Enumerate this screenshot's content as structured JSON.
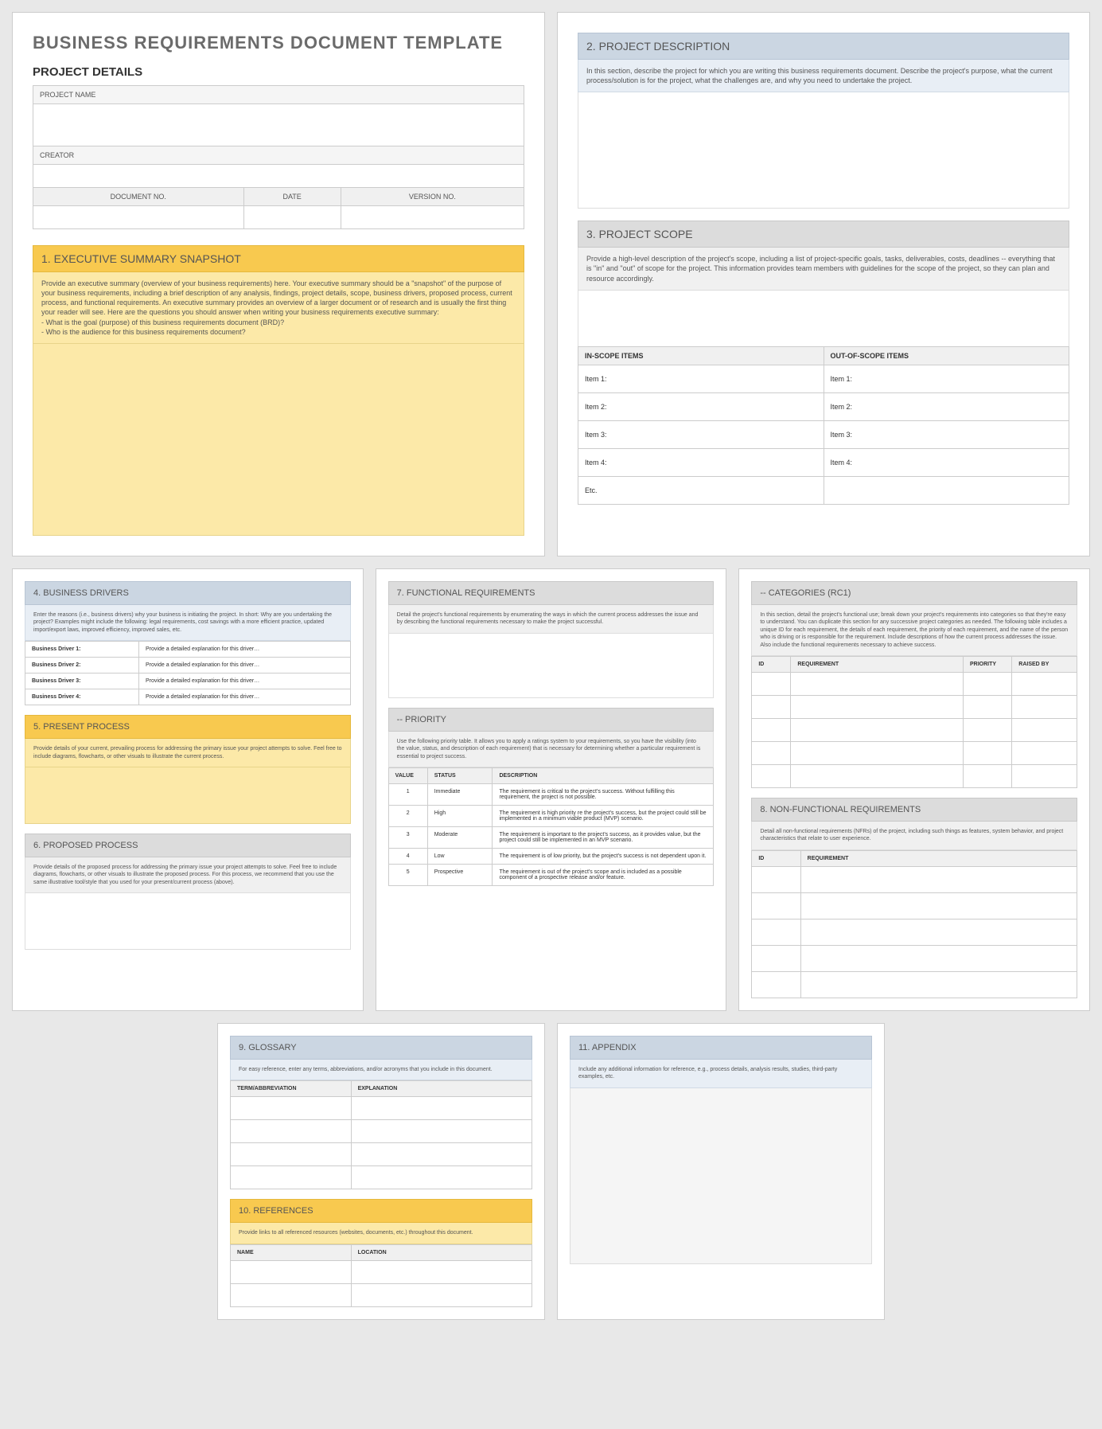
{
  "title": "BUSINESS REQUIREMENTS DOCUMENT TEMPLATE",
  "pd_title": "PROJECT DETAILS",
  "pn": "PROJECT NAME",
  "cr": "CREATOR",
  "docno": "DOCUMENT NO.",
  "date": "DATE",
  "ver": "VERSION NO.",
  "s1": {
    "h": "1. EXECUTIVE SUMMARY SNAPSHOT",
    "b": "Provide an executive summary (overview of your business requirements) here. Your executive summary should be a \"snapshot\" of the purpose of your business requirements, including a brief description of any analysis, findings, project details, scope, business drivers, proposed process, current process, and functional requirements. An executive summary provides an overview of a larger document or of research and is usually the first thing your reader will see. Here are the questions you should answer when writing your business requirements executive summary:\n- What is the goal (purpose) of this business requirements document (BRD)?\n- Who is the audience for this business requirements document?"
  },
  "s2": {
    "h": "2. PROJECT DESCRIPTION",
    "b": "In this section, describe the project for which you are writing this business requirements document. Describe the project's purpose, what the current process/solution is for the project, what the challenges are, and why you need to undertake the project."
  },
  "s3": {
    "h": "3. PROJECT SCOPE",
    "b": "Provide a high-level description of the project's scope, including a list of project-specific goals, tasks, deliverables, costs, deadlines -- everything that is \"in\" and \"out\" of scope for the project. This information provides team members with guidelines for the scope of the project, so they can plan and resource accordingly.",
    "in": "IN-SCOPE ITEMS",
    "out": "OUT-OF-SCOPE ITEMS",
    "rows": [
      "Item 1:",
      "Item 2:",
      "Item 3:",
      "Item 4:",
      "Etc."
    ]
  },
  "s4": {
    "h": "4. BUSINESS DRIVERS",
    "b": "Enter the reasons (i.e., business drivers) why your business is initiating the project. In short: Why are you undertaking the project? Examples might include the following: legal requirements, cost savings with a more efficient practice, updated import/export laws, improved efficiency, improved sales, etc.",
    "rows": [
      "Business Driver 1:",
      "Business Driver 2:",
      "Business Driver 3:",
      "Business Driver 4:"
    ],
    "exp": "Provide a detailed explanation for this driver…"
  },
  "s5": {
    "h": "5. PRESENT PROCESS",
    "b": "Provide details of your current, prevailing process for addressing the primary issue your project attempts to solve. Feel free to include diagrams, flowcharts, or other visuals to illustrate the current process."
  },
  "s6": {
    "h": "6. PROPOSED PROCESS",
    "b": "Provide details of the proposed process for addressing the primary issue your project attempts to solve. Feel free to include diagrams, flowcharts, or other visuals to illustrate the proposed process. For this process, we recommend that you use the same illustrative tool/style that you used for your present/current process (above)."
  },
  "s7": {
    "h": "7. FUNCTIONAL REQUIREMENTS",
    "b": "Detail the project's functional requirements by enumerating the ways in which the current process addresses the issue and by describing the functional requirements necessary to make the project successful."
  },
  "pr": {
    "h": "-- PRIORITY",
    "b": "Use the following priority table. It allows you to apply a ratings system to your requirements, so you have the visibility (into the value, status, and description of each requirement) that is necessary for determining whether a particular requirement is essential to project success.",
    "c1": "VALUE",
    "c2": "STATUS",
    "c3": "DESCRIPTION",
    "rows": [
      {
        "v": "1",
        "s": "Immediate",
        "d": "The requirement is critical to the project's success. Without fulfilling this requirement, the project is not possible."
      },
      {
        "v": "2",
        "s": "High",
        "d": "The requirement is high priority re the project's success, but the project could still be implemented in a minimum viable product (MVP) scenario."
      },
      {
        "v": "3",
        "s": "Moderate",
        "d": "The requirement is important to the project's success, as it provides value, but the project could still be implemented in an MVP scenario."
      },
      {
        "v": "4",
        "s": "Low",
        "d": "The requirement is of low priority, but the project's success is not dependent upon it."
      },
      {
        "v": "5",
        "s": "Prospective",
        "d": "The requirement is out of the project's scope and is included as a possible component of a prospective release and/or feature."
      }
    ]
  },
  "cat": {
    "h": "-- CATEGORIES (RC1)",
    "b": "In this section, detail the project's functional use; break down your project's requirements into categories so that they're easy to understand. You can duplicate this section for any successive project categories as needed. The following table includes a unique ID for each requirement, the details of each requirement, the priority of each requirement, and the name of the person who is driving or is responsible for the requirement. Include descriptions of how the current process addresses the issue. Also include the functional requirements necessary to achieve success.",
    "c1": "ID",
    "c2": "REQUIREMENT",
    "c3": "PRIORITY",
    "c4": "RAISED BY"
  },
  "s8": {
    "h": "8. NON-FUNCTIONAL REQUIREMENTS",
    "b": "Detail all non-functional requirements (NFRs) of the project, including such things as features, system behavior, and project characteristics that relate to user experience.",
    "c1": "ID",
    "c2": "REQUIREMENT"
  },
  "s9": {
    "h": "9. GLOSSARY",
    "b": "For easy reference, enter any terms, abbreviations, and/or acronyms that you include in this document.",
    "c1": "TERM/ABBREVIATION",
    "c2": "EXPLANATION"
  },
  "s10": {
    "h": "10. REFERENCES",
    "b": "Provide links to all referenced resources (websites, documents, etc.) throughout this document.",
    "c1": "NAME",
    "c2": "LOCATION"
  },
  "s11": {
    "h": "11. APPENDIX",
    "b": "Include any additional information for reference, e.g., process details, analysis results, studies, third-party examples, etc."
  }
}
